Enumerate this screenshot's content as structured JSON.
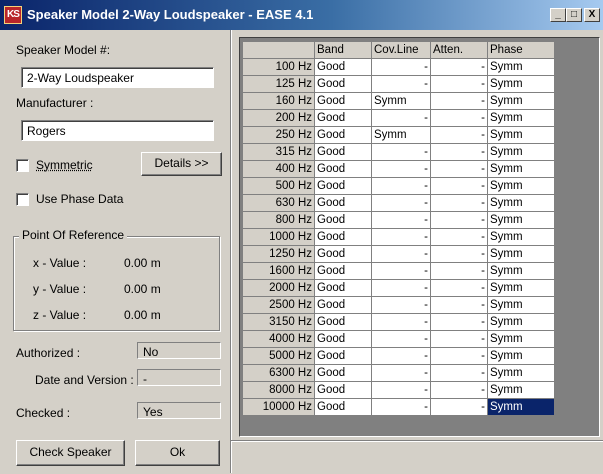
{
  "window": {
    "title": "Speaker Model 2-Way Loudspeaker - EASE 4.1",
    "icon_text": "KS",
    "minimize": "_",
    "maximize": "□",
    "close": "X"
  },
  "form": {
    "speaker_model_label": "Speaker Model #:",
    "speaker_model_value": "2-Way Loudspeaker",
    "manufacturer_label": "Manufacturer :",
    "manufacturer_value": "Rogers",
    "symmetric_label": "Symmetric",
    "details_button": "Details >>",
    "use_phase_label": "Use Phase Data",
    "reference_group": "Point Of Reference",
    "x_label": "x - Value :",
    "x_value": "0.00 m",
    "y_label": "y - Value :",
    "y_value": "0.00 m",
    "z_label": "z - Value :",
    "z_value": "0.00 m",
    "authorized_label": "Authorized :",
    "authorized_value": "No",
    "date_version_label": "Date and Version :",
    "date_version_value": "-",
    "checked_label": "Checked :",
    "checked_value": "Yes",
    "check_speaker_button": "Check Speaker",
    "ok_button": "Ok"
  },
  "grid": {
    "columns": [
      "",
      "Band",
      "Cov.Line",
      "Atten.",
      "Phase"
    ],
    "rows": [
      {
        "freq": "100 Hz",
        "band": "Good",
        "cov": "-",
        "att": "-",
        "phase": "Symm"
      },
      {
        "freq": "125 Hz",
        "band": "Good",
        "cov": "-",
        "att": "-",
        "phase": "Symm"
      },
      {
        "freq": "160 Hz",
        "band": "Good",
        "cov": "Symm",
        "att": "-",
        "phase": "Symm"
      },
      {
        "freq": "200 Hz",
        "band": "Good",
        "cov": "-",
        "att": "-",
        "phase": "Symm"
      },
      {
        "freq": "250 Hz",
        "band": "Good",
        "cov": "Symm",
        "att": "-",
        "phase": "Symm"
      },
      {
        "freq": "315 Hz",
        "band": "Good",
        "cov": "-",
        "att": "-",
        "phase": "Symm"
      },
      {
        "freq": "400 Hz",
        "band": "Good",
        "cov": "-",
        "att": "-",
        "phase": "Symm"
      },
      {
        "freq": "500 Hz",
        "band": "Good",
        "cov": "-",
        "att": "-",
        "phase": "Symm"
      },
      {
        "freq": "630 Hz",
        "band": "Good",
        "cov": "-",
        "att": "-",
        "phase": "Symm"
      },
      {
        "freq": "800 Hz",
        "band": "Good",
        "cov": "-",
        "att": "-",
        "phase": "Symm"
      },
      {
        "freq": "1000 Hz",
        "band": "Good",
        "cov": "-",
        "att": "-",
        "phase": "Symm"
      },
      {
        "freq": "1250 Hz",
        "band": "Good",
        "cov": "-",
        "att": "-",
        "phase": "Symm"
      },
      {
        "freq": "1600 Hz",
        "band": "Good",
        "cov": "-",
        "att": "-",
        "phase": "Symm"
      },
      {
        "freq": "2000 Hz",
        "band": "Good",
        "cov": "-",
        "att": "-",
        "phase": "Symm"
      },
      {
        "freq": "2500 Hz",
        "band": "Good",
        "cov": "-",
        "att": "-",
        "phase": "Symm"
      },
      {
        "freq": "3150 Hz",
        "band": "Good",
        "cov": "-",
        "att": "-",
        "phase": "Symm"
      },
      {
        "freq": "4000 Hz",
        "band": "Good",
        "cov": "-",
        "att": "-",
        "phase": "Symm"
      },
      {
        "freq": "5000 Hz",
        "band": "Good",
        "cov": "-",
        "att": "-",
        "phase": "Symm"
      },
      {
        "freq": "6300 Hz",
        "band": "Good",
        "cov": "-",
        "att": "-",
        "phase": "Symm"
      },
      {
        "freq": "8000 Hz",
        "band": "Good",
        "cov": "-",
        "att": "-",
        "phase": "Symm"
      },
      {
        "freq": "10000 Hz",
        "band": "Good",
        "cov": "-",
        "att": "-",
        "phase": "Symm",
        "selected": true
      }
    ]
  },
  "colors": {
    "title_gradient_start": "#0a246a",
    "title_gradient_end": "#a6caf0",
    "window_face": "#d4d0c8",
    "selection": "#0a246a"
  }
}
